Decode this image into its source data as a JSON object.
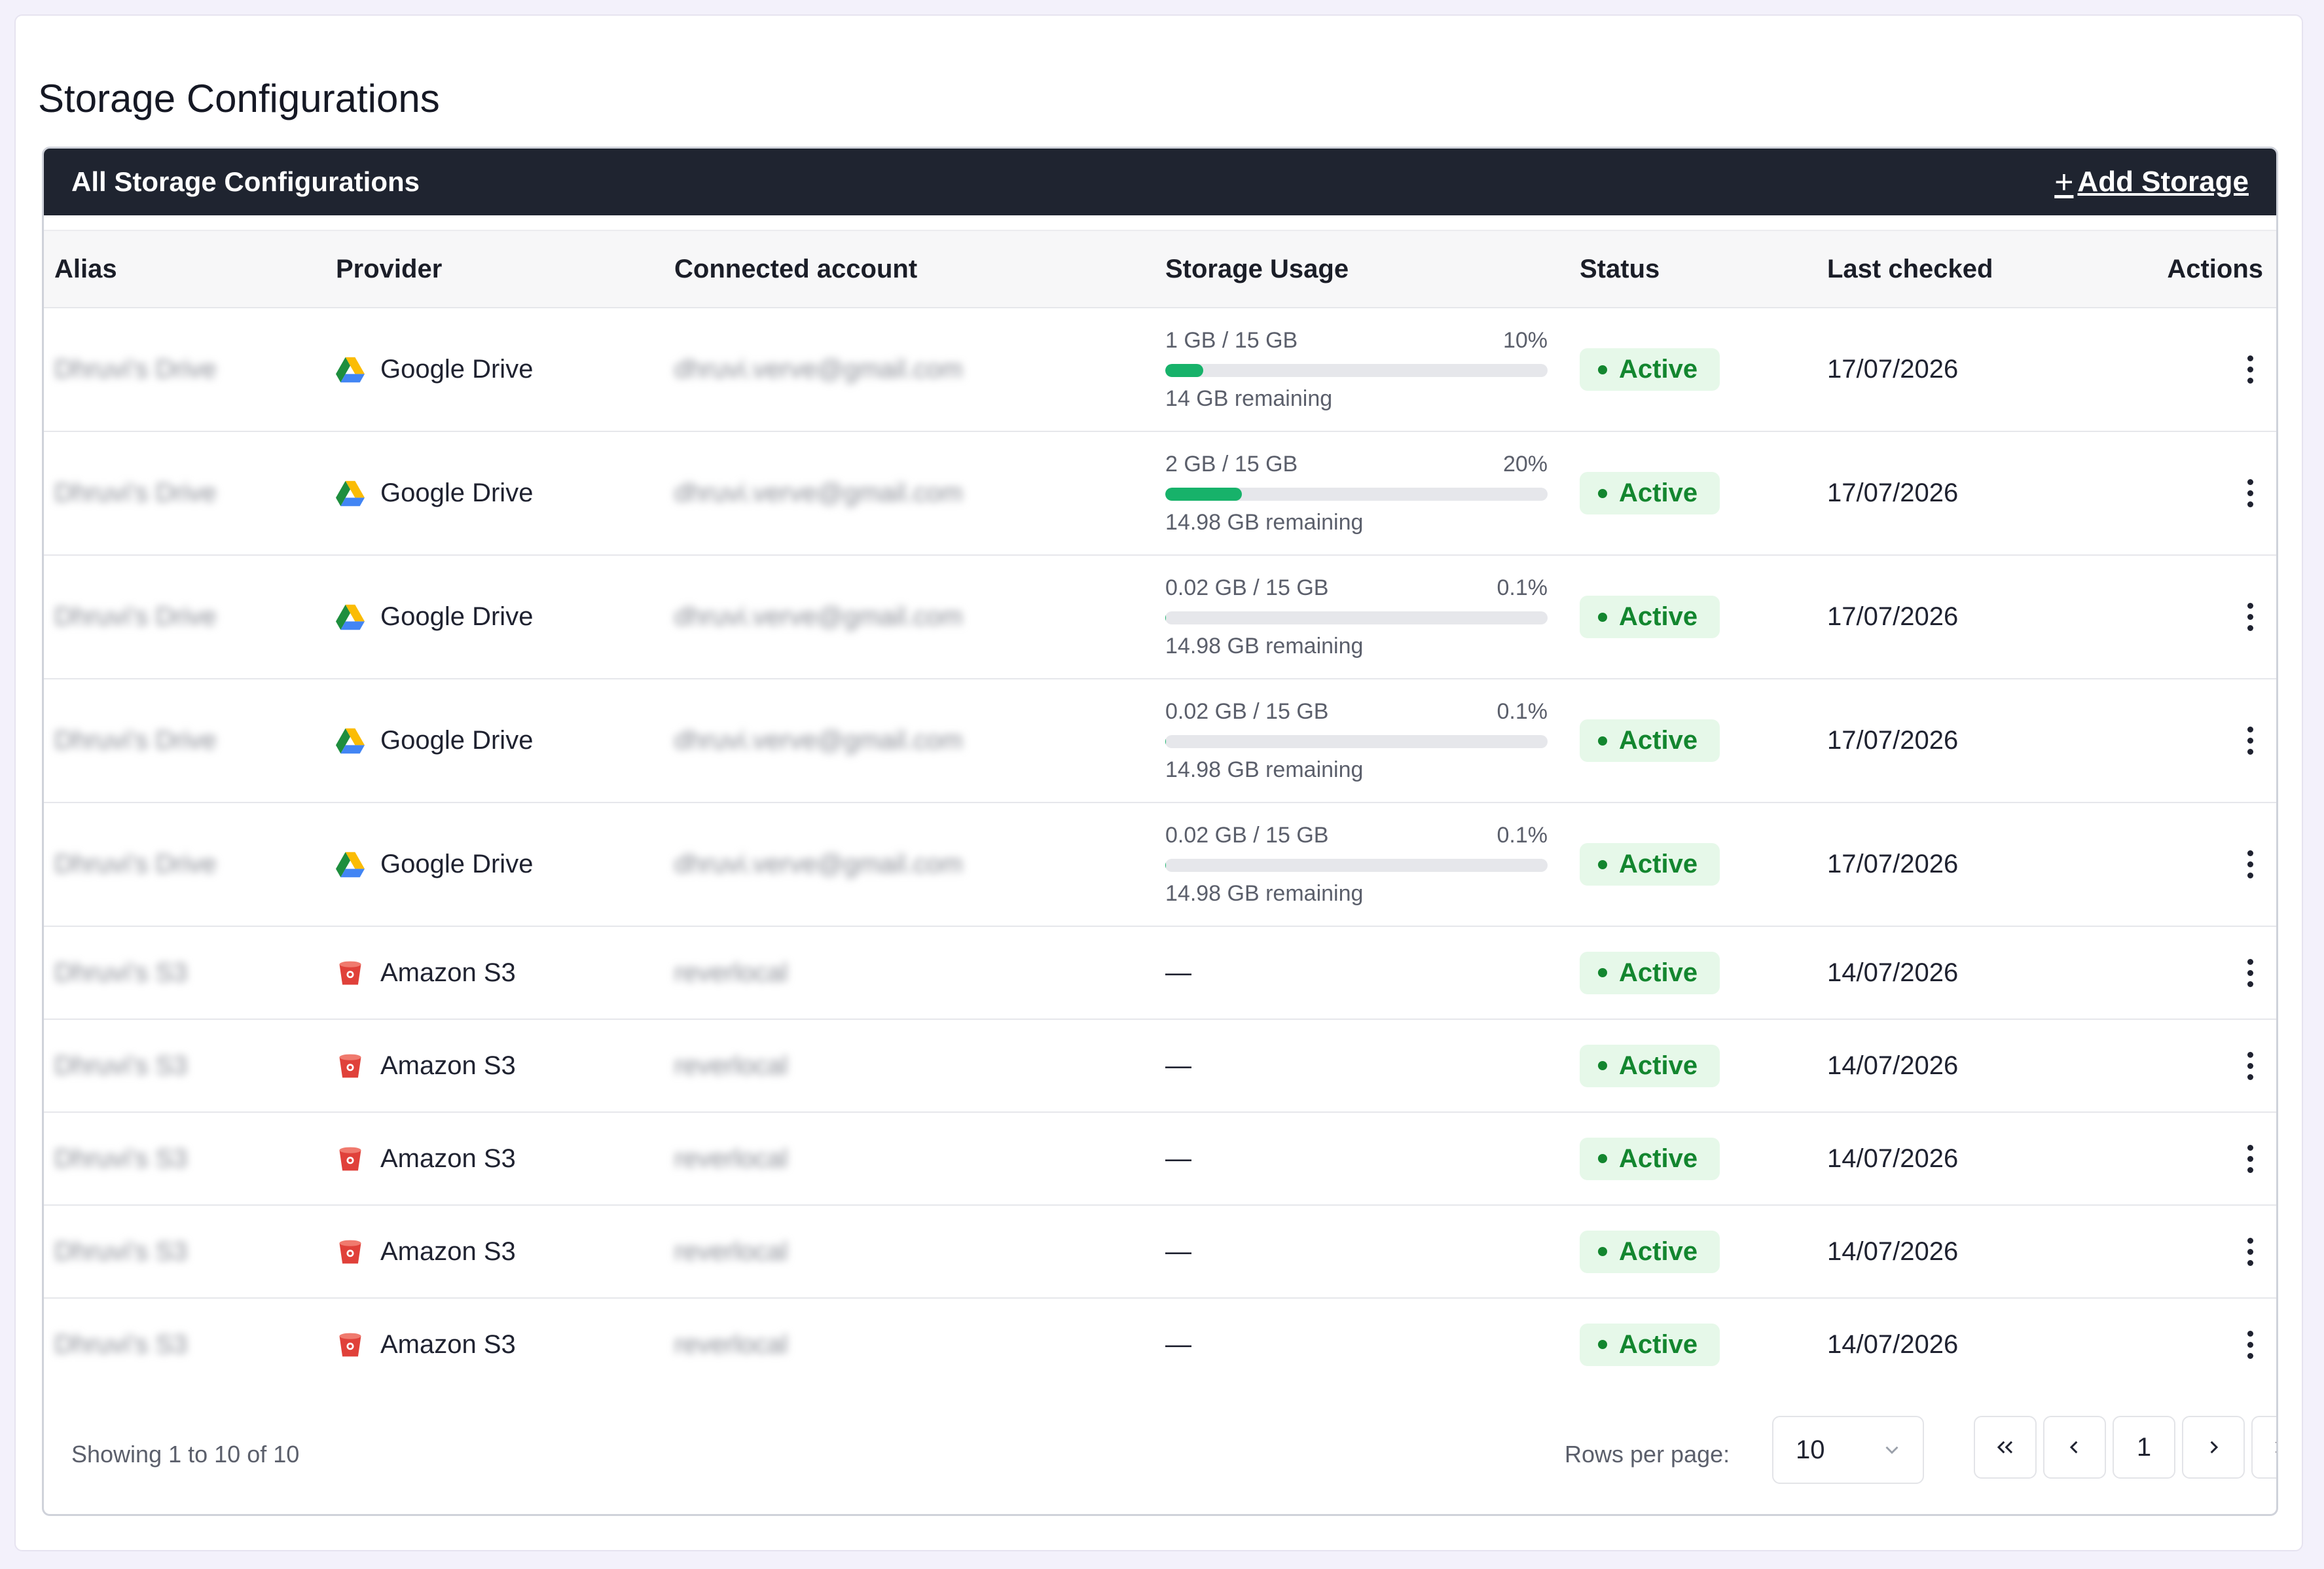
{
  "page": {
    "title": "Storage Configurations"
  },
  "card": {
    "title": "All Storage Configurations",
    "add_label": "Add Storage"
  },
  "columns": {
    "alias": "Alias",
    "provider": "Provider",
    "account": "Connected account",
    "usage": "Storage Usage",
    "status": "Status",
    "last_checked": "Last checked",
    "actions": "Actions"
  },
  "rows": [
    {
      "alias": "Dhruvi's Drive",
      "provider": "Google Drive",
      "provider_icon": "google-drive-icon",
      "account": "dhruvi.verve@gmail.com",
      "usage": {
        "used": "1 GB / 15 GB",
        "percent_label": "10%",
        "percent": 10,
        "remaining": "14 GB remaining"
      },
      "status": "Active",
      "last_checked": "17/07/2026"
    },
    {
      "alias": "Dhruvi's Drive",
      "provider": "Google Drive",
      "provider_icon": "google-drive-icon",
      "account": "dhruvi.verve@gmail.com",
      "usage": {
        "used": "2 GB / 15 GB",
        "percent_label": "20%",
        "percent": 20,
        "remaining": "14.98 GB remaining"
      },
      "status": "Active",
      "last_checked": "17/07/2026"
    },
    {
      "alias": "Dhruvi's Drive",
      "provider": "Google Drive",
      "provider_icon": "google-drive-icon",
      "account": "dhruvi.verve@gmail.com",
      "usage": {
        "used": "0.02 GB / 15 GB",
        "percent_label": "0.1%",
        "percent": 0.1,
        "remaining": "14.98 GB remaining"
      },
      "status": "Active",
      "last_checked": "17/07/2026"
    },
    {
      "alias": "Dhruvi's Drive",
      "provider": "Google Drive",
      "provider_icon": "google-drive-icon",
      "account": "dhruvi.verve@gmail.com",
      "usage": {
        "used": "0.02 GB / 15 GB",
        "percent_label": "0.1%",
        "percent": 0.1,
        "remaining": "14.98 GB remaining"
      },
      "status": "Active",
      "last_checked": "17/07/2026"
    },
    {
      "alias": "Dhruvi's Drive",
      "provider": "Google Drive",
      "provider_icon": "google-drive-icon",
      "account": "dhruvi.verve@gmail.com",
      "usage": {
        "used": "0.02 GB / 15 GB",
        "percent_label": "0.1%",
        "percent": 0.1,
        "remaining": "14.98 GB remaining"
      },
      "status": "Active",
      "last_checked": "17/07/2026"
    },
    {
      "alias": "Dhruvi's S3",
      "provider": "Amazon S3",
      "provider_icon": "amazon-s3-icon",
      "account": "reverlocal",
      "usage": null,
      "usage_empty": "—",
      "status": "Active",
      "last_checked": "14/07/2026"
    },
    {
      "alias": "Dhruvi's S3",
      "provider": "Amazon S3",
      "provider_icon": "amazon-s3-icon",
      "account": "reverlocal",
      "usage": null,
      "usage_empty": "—",
      "status": "Active",
      "last_checked": "14/07/2026"
    },
    {
      "alias": "Dhruvi's S3",
      "provider": "Amazon S3",
      "provider_icon": "amazon-s3-icon",
      "account": "reverlocal",
      "usage": null,
      "usage_empty": "—",
      "status": "Active",
      "last_checked": "14/07/2026"
    },
    {
      "alias": "Dhruvi's S3",
      "provider": "Amazon S3",
      "provider_icon": "amazon-s3-icon",
      "account": "reverlocal",
      "usage": null,
      "usage_empty": "—",
      "status": "Active",
      "last_checked": "14/07/2026"
    },
    {
      "alias": "Dhruvi's S3",
      "provider": "Amazon S3",
      "provider_icon": "amazon-s3-icon",
      "account": "reverlocal",
      "usage": null,
      "usage_empty": "—",
      "status": "Active",
      "last_checked": "14/07/2026"
    }
  ],
  "colors": {
    "header_bg": "#1f2430",
    "active_bg": "#e6f8e9",
    "active_text": "#13862f",
    "progress": "#17b26a"
  },
  "footer": {
    "showing": "Showing 1 to 10 of 10",
    "rows_per_page_label": "Rows per page:",
    "rows_per_page_value": "10",
    "current_page": "1"
  }
}
